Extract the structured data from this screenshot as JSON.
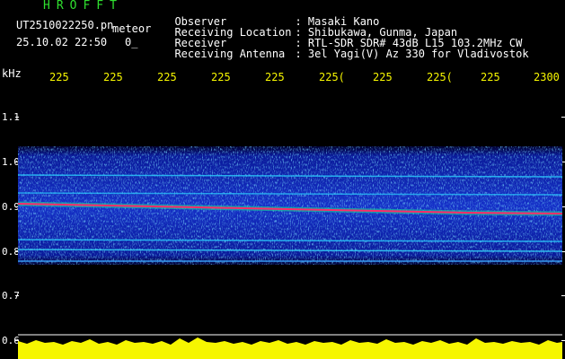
{
  "header": {
    "title": "HROFFT",
    "filename": "UT2510022250.pn",
    "mode": "meteor",
    "datetime": "25.10.02 22:50",
    "counter": "0_",
    "meta": [
      {
        "label": "Observer",
        "value": ": Masaki Kano"
      },
      {
        "label": "Receiving Location",
        "value": ": Shibukawa, Gunma, Japan"
      },
      {
        "label": "Receiver",
        "value": ": RTL-SDR SDR# 43dB L15 103.2MHz CW"
      },
      {
        "label": "Receiving Antenna",
        "value": ": 3el Yagi(V) Az 330 for Vladivostok"
      }
    ]
  },
  "axis": {
    "unit": "kHz",
    "y_labels": [
      "1.1",
      "1.0",
      "0.9",
      "0.8",
      "0.7",
      "0.6"
    ],
    "x_labels": [
      "225",
      "225",
      "225",
      "225",
      "225",
      "225(",
      "225",
      "225(",
      "225",
      "2300"
    ]
  },
  "colors": {
    "background": "#000000",
    "label_yellow": "#f6f600",
    "title_green": "#2fe02f"
  }
}
